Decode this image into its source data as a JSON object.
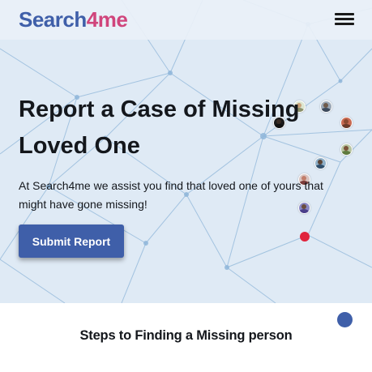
{
  "navbar": {
    "logo_part1": "Search",
    "logo_part2": "4",
    "logo_part3": "me",
    "menu_icon": "hamburger-menu-icon"
  },
  "hero": {
    "headline": "Report a Case of Missing Loved One",
    "subtext": "At Search4me we assist you find that loved one of yours that might have gone missing!",
    "button_label": "Submit Report",
    "background_color": "#dfeaf5",
    "network_line_color": "#8fb6d9"
  },
  "section": {
    "title": "Steps to Finding a Missing person"
  },
  "scroll_top_icon": "scroll-to-top-icon",
  "colors": {
    "brand_blue": "#3f5fa9",
    "brand_pink": "#d0457c",
    "alert_red": "#e0243d",
    "text_dark": "#14171c"
  }
}
